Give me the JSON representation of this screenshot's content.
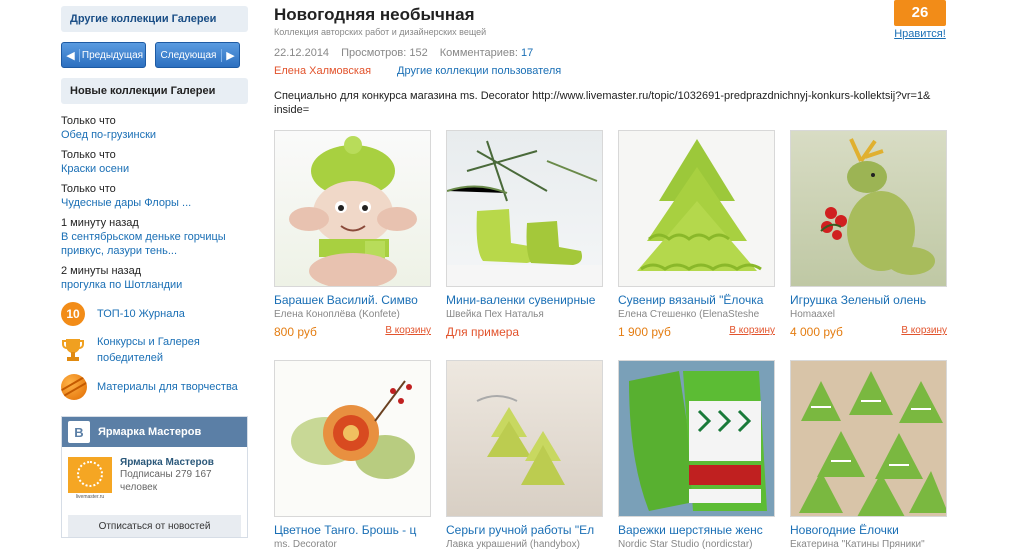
{
  "sidebar": {
    "other_collections": "Другие коллекции Галереи",
    "prev": "Предыдущая",
    "next": "Следующая",
    "new_collections": "Новые коллекции Галереи",
    "recent": [
      {
        "time": "Только что",
        "title": "Обед по-грузински"
      },
      {
        "time": "Только что",
        "title": "Краски осени"
      },
      {
        "time": "Только что",
        "title": "Чудесные дары Флоры ..."
      },
      {
        "time": "1 минуту назад",
        "title": "В сентябрьском деньке горчицы привкус, лазури тень..."
      },
      {
        "time": "2 минуты назад",
        "title": "прогулка по Шотландии"
      }
    ],
    "top10_badge": "10",
    "top10": "ТОП-10 Журнала",
    "contests": "Конкурсы и Галерея победителей",
    "materials": "Материалы для творчества",
    "vk": {
      "logo": "B",
      "header": "Ярмарка Мастеров",
      "name": "Ярмарка Мастеров",
      "subscribers": "Подписаны 279 167 человек",
      "avatar_caption": "livemaster.ru",
      "unsubscribe": "Отписаться от новостей"
    }
  },
  "main": {
    "title": "Новогодняя необычная",
    "subtitle": "Коллекция авторских работ и дизайнерских вещей",
    "date": "22.12.2014",
    "views_label": "Просмотров: 152",
    "comments_label": "Комментариев:",
    "comments_count": "17",
    "author": "Елена Халмовская",
    "user_collections": "Другие коллекции пользователя",
    "description": "Специально для конкурса магазина ms. Decorator http://www.livemaster.ru/topic/1032691-predprazdnichnyj-konkurs-kollektsij?vr=1& inside="
  },
  "like": {
    "count": "26",
    "label": "Нравится!"
  },
  "cards": [
    {
      "title": "Барашек Василий. Симво",
      "author": "Елена Коноплёва (Konfete)",
      "price": "800 руб",
      "cart": "В корзину"
    },
    {
      "title": "Мини-валенки сувенирные",
      "author": "Швейка Пех Наталья",
      "price": "Для примера",
      "cart": ""
    },
    {
      "title": "Сувенир вязаный \"Ёлочка",
      "author": "Елена Стешенко (ElenaSteshe",
      "price": "1 900 руб",
      "cart": "В корзину"
    },
    {
      "title": "Игрушка Зеленый олень",
      "author": "Homaaxel",
      "price": "4 000 руб",
      "cart": "В корзину"
    },
    {
      "title": "Цветное Танго. Брошь - ц",
      "author": "ms. Decorator",
      "price": "",
      "cart": ""
    },
    {
      "title": "Серьги ручной работы \"Ел",
      "author": "Лавка украшений (handybox)",
      "price": "",
      "cart": ""
    },
    {
      "title": "Варежки шерстяные женс",
      "author": "Nordic Star Studio (nordicstar)",
      "price": "",
      "cart": ""
    },
    {
      "title": "Новогодние Ёлочки",
      "author": "Екатерина \"Катины Пряники\"",
      "price": "",
      "cart": ""
    }
  ]
}
